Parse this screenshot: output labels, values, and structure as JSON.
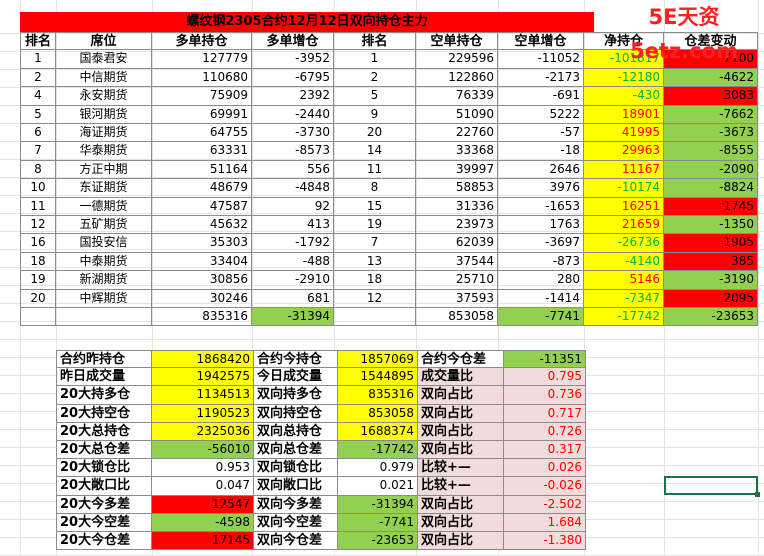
{
  "title": "螺纹钢2305合约12月12日双向持仓主力",
  "watermark": "5E天资5etz.com",
  "colors": {
    "red": "#ff0000",
    "green": "#92d050",
    "yellow": "#ffff00",
    "pink": "#f2dcdb",
    "light_yellow": "#fff2cc",
    "text_green": "#00b050"
  },
  "headers": [
    "排名",
    "席位",
    "多单持仓",
    "多单增仓",
    "排名",
    "空单持仓",
    "空单增仓",
    "净持仓",
    "仓差变动"
  ],
  "rows": [
    [
      "1",
      "国泰君安",
      "127779",
      "-3952",
      "1",
      "229596",
      "-11052",
      "-101817",
      "7100"
    ],
    [
      "2",
      "中信期货",
      "110680",
      "-6795",
      "2",
      "122860",
      "-2173",
      "-12180",
      "-4622"
    ],
    [
      "4",
      "永安期货",
      "75909",
      "2392",
      "5",
      "76339",
      "-691",
      "-430",
      "3083"
    ],
    [
      "5",
      "银河期货",
      "69991",
      "-2440",
      "9",
      "51090",
      "5222",
      "18901",
      "-7662"
    ],
    [
      "6",
      "海证期货",
      "64755",
      "-3730",
      "20",
      "22760",
      "-57",
      "41995",
      "-3673"
    ],
    [
      "7",
      "华泰期货",
      "63331",
      "-8573",
      "14",
      "33368",
      "-18",
      "29963",
      "-8555"
    ],
    [
      "8",
      "方正中期",
      "51164",
      "556",
      "11",
      "39997",
      "2646",
      "11167",
      "-2090"
    ],
    [
      "10",
      "东证期货",
      "48679",
      "-4848",
      "8",
      "58853",
      "3976",
      "-10174",
      "-8824"
    ],
    [
      "11",
      "一德期货",
      "47587",
      "92",
      "15",
      "31336",
      "-1653",
      "16251",
      "1745"
    ],
    [
      "12",
      "五矿期货",
      "45632",
      "413",
      "19",
      "23973",
      "1763",
      "21659",
      "-1350"
    ],
    [
      "16",
      "国投安信",
      "35303",
      "-1792",
      "7",
      "62039",
      "-3697",
      "-26736",
      "1905"
    ],
    [
      "18",
      "中泰期货",
      "33404",
      "-488",
      "13",
      "37544",
      "-873",
      "-4140",
      "385"
    ],
    [
      "19",
      "新湖期货",
      "30856",
      "-2910",
      "18",
      "25710",
      "280",
      "5146",
      "-3190"
    ],
    [
      "20",
      "中辉期货",
      "30246",
      "681",
      "12",
      "37593",
      "-1414",
      "-7347",
      "2095"
    ]
  ],
  "totals": {
    "long": "835316",
    "long_change": "-31394",
    "short": "853058",
    "short_change": "-7741",
    "net": "-17742",
    "diff_change": "-23653"
  },
  "summary": [
    [
      "合约昨持仓",
      "1868420",
      "合约今持仓",
      "1857069",
      "合约今仓差",
      "-11351"
    ],
    [
      "昨日成交量",
      "1942575",
      "今日成交量",
      "1544895",
      "成交量比",
      "0.795"
    ],
    [
      "20大持多仓",
      "1134513",
      "双向持多仓",
      "835316",
      "双向占比",
      "0.736"
    ],
    [
      "20大持空仓",
      "1190523",
      "双向持空仓",
      "853058",
      "双向占比",
      "0.717"
    ],
    [
      "20大总持仓",
      "2325036",
      "双向总持仓",
      "1688374",
      "双向占比",
      "0.726"
    ],
    [
      "20大总仓差",
      "-56010",
      "双向总仓差",
      "-17742",
      "双向占比",
      "0.317"
    ],
    [
      "20大锁仓比",
      "0.953",
      "双向锁仓比",
      "0.979",
      "比较+—",
      "0.026"
    ],
    [
      "20大敞口比",
      "0.047",
      "双向敞口比",
      "0.021",
      "比较+—",
      "-0.026"
    ],
    [
      "20大今多差",
      "12547",
      "双向今多差",
      "-31394",
      "双向占比",
      "-2.502"
    ],
    [
      "20大今空差",
      "-4598",
      "双向今空差",
      "-7741",
      "双向占比",
      "1.684"
    ],
    [
      "20大今仓差",
      "17145",
      "双向今仓差",
      "-23653",
      "双向占比",
      "-1.380"
    ]
  ]
}
